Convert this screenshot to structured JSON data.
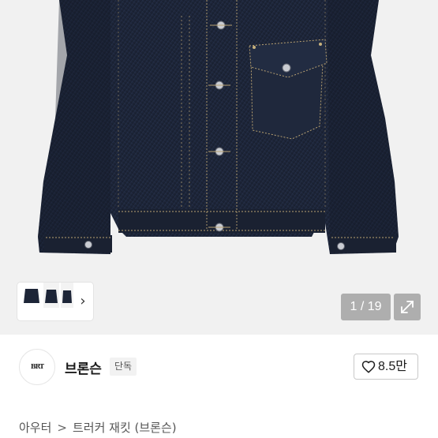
{
  "gallery": {
    "current_page": 1,
    "total_pages": 19,
    "counter_text": "1 / 19",
    "thumb_next_icon": "chevron-right-icon",
    "expand_icon": "expand-icon"
  },
  "seller": {
    "logo_text": "BRT",
    "name": "브론슨",
    "badge": "단독"
  },
  "like": {
    "icon": "heart-outline-icon",
    "count": "8.5만"
  },
  "breadcrumb": {
    "category": "아우터",
    "separator": ">",
    "product": "트러커 재킷 (브론슨)"
  },
  "colors": {
    "denim": "#1d2537",
    "stitch": "#b9a272",
    "background": "#f1f1f1"
  }
}
